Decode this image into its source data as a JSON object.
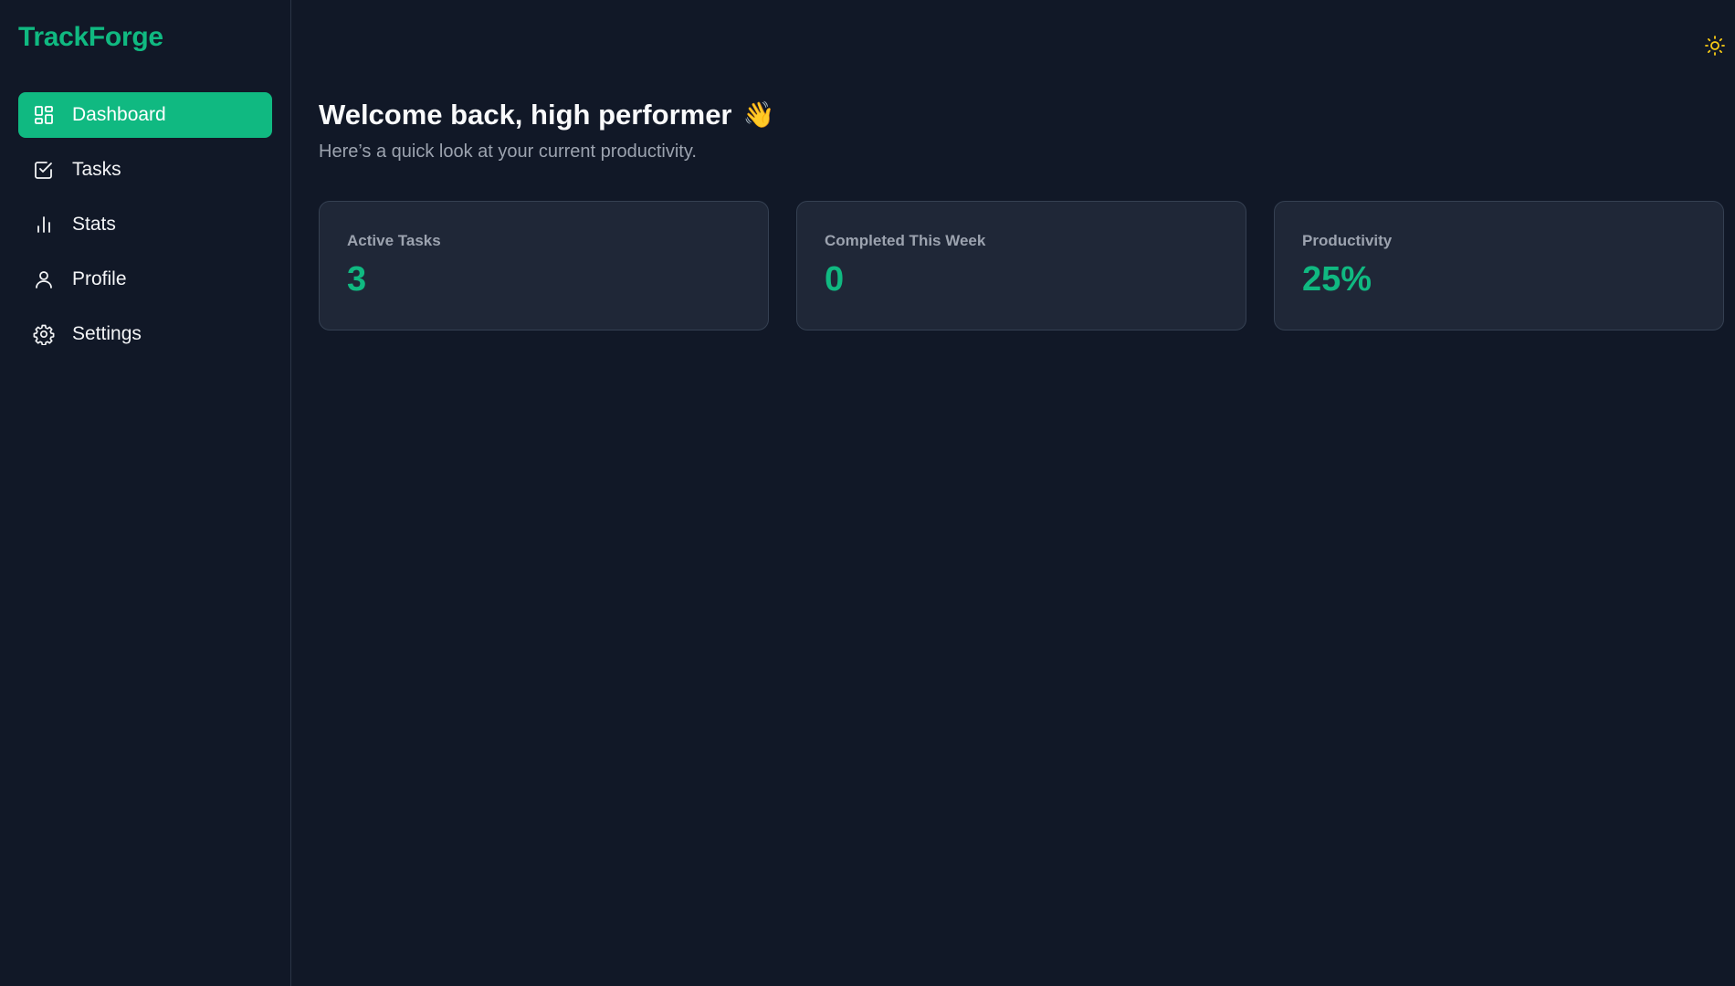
{
  "app": {
    "brand": "TrackForge",
    "accent_color": "#10b981",
    "background_color": "#111827",
    "card_color": "#1f2737"
  },
  "sidebar": {
    "items": [
      {
        "label": "Dashboard",
        "icon": "dashboard-icon",
        "active": true
      },
      {
        "label": "Tasks",
        "icon": "checkbox-icon",
        "active": false
      },
      {
        "label": "Stats",
        "icon": "bar-chart-icon",
        "active": false
      },
      {
        "label": "Profile",
        "icon": "user-icon",
        "active": false
      },
      {
        "label": "Settings",
        "icon": "gear-icon",
        "active": false
      }
    ]
  },
  "header": {
    "theme_toggle_icon": "sun-icon",
    "theme_toggle_color": "#facc15"
  },
  "main": {
    "title": "Welcome back, high performer",
    "title_emoji": "👋",
    "subtitle": "Here’s a quick look at your current productivity.",
    "stats": [
      {
        "label": "Active Tasks",
        "value": "3"
      },
      {
        "label": "Completed This Week",
        "value": "0"
      },
      {
        "label": "Productivity",
        "value": "25%"
      }
    ]
  }
}
